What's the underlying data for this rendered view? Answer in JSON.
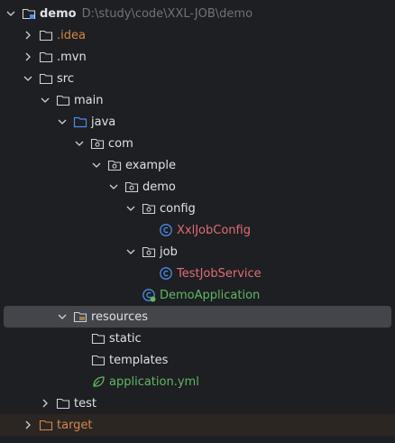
{
  "project_tree": {
    "root": {
      "label": "demo",
      "path": "D:\\study\\code\\XXL-JOB\\demo"
    },
    "items": [
      {
        "label": ".idea"
      },
      {
        "label": ".mvn"
      },
      {
        "label": "src"
      },
      {
        "label": "main"
      },
      {
        "label": "java"
      },
      {
        "label": "com"
      },
      {
        "label": "example"
      },
      {
        "label": "demo"
      },
      {
        "label": "config"
      },
      {
        "label": "XxlJobConfig"
      },
      {
        "label": "job"
      },
      {
        "label": "TestJobService"
      },
      {
        "label": "DemoApplication"
      },
      {
        "label": "resources"
      },
      {
        "label": "static"
      },
      {
        "label": "templates"
      },
      {
        "label": "application.yml"
      },
      {
        "label": "test"
      },
      {
        "label": "target"
      }
    ]
  },
  "colors": {
    "background": "#1e1f22",
    "selected_row": "#43454a",
    "excluded_row": "#2b2622",
    "excluded_text": "#d5874a",
    "class_text": "#e06c75",
    "spring_text": "#5fb865",
    "class_icon": "#4d8be8",
    "folder_outline": "#cfd1d6",
    "source_folder": "#4d8be8"
  },
  "icons": {
    "expand": "chevron-down-icon",
    "collapse": "chevron-right-icon",
    "folder": "folder-icon",
    "package": "package-icon",
    "class": "class-icon",
    "spring_boot_app": "spring-boot-class-icon",
    "yaml": "spring-config-icon"
  }
}
